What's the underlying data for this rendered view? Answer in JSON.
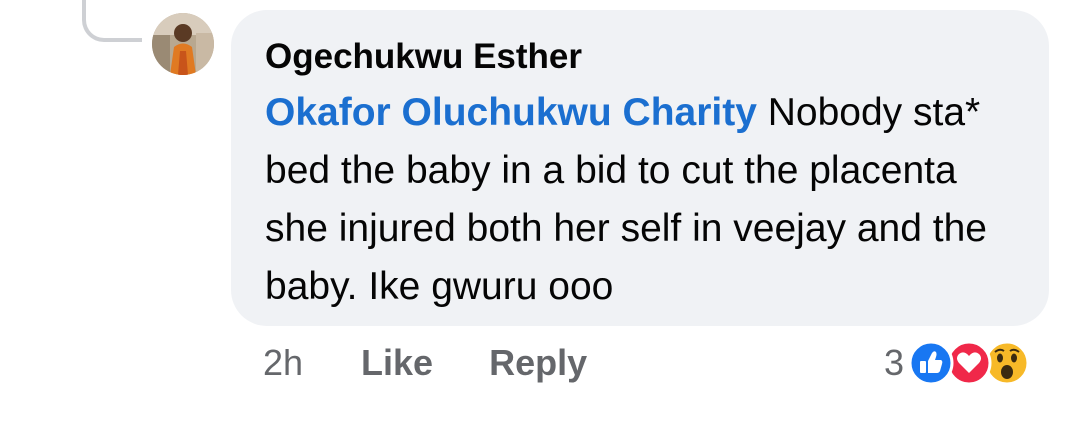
{
  "comment": {
    "author": "Ogechukwu Esther",
    "mention": "Okafor Oluchukwu Charity",
    "text": " Nobody sta* bed the baby in a bid to cut the placenta she injured both her self in veejay and the baby. Ike gwuru ooo"
  },
  "meta": {
    "time": "2h",
    "like_label": "Like",
    "reply_label": "Reply"
  },
  "reactions": {
    "count": "3",
    "icons": [
      "like-icon",
      "love-icon",
      "wow-icon"
    ],
    "colors": {
      "like": "#1877f2",
      "love": "#f02849",
      "wow": "#f7b928"
    }
  },
  "colors": {
    "bubble": "#f0f2f5",
    "mention": "#1b6fd0",
    "meta_text": "#65676b",
    "thread_line": "#ced0d4"
  }
}
